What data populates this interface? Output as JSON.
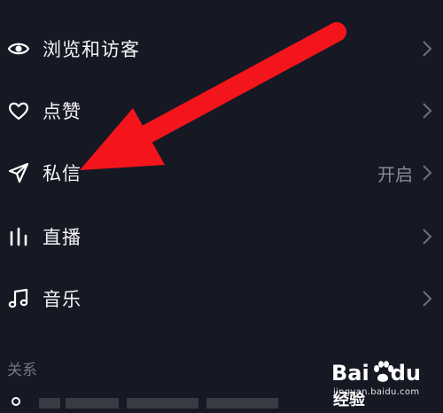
{
  "menu": {
    "items": [
      {
        "label": "浏览和访客",
        "icon": "eye-icon"
      },
      {
        "label": "点赞",
        "icon": "heart-icon"
      },
      {
        "label": "私信",
        "icon": "paper-plane-icon",
        "value": "开启"
      },
      {
        "label": "直播",
        "icon": "bar-chart-icon"
      },
      {
        "label": "音乐",
        "icon": "music-note-icon"
      }
    ]
  },
  "section": {
    "title": "关系"
  },
  "watermark": {
    "brand_prefix": "Bai",
    "brand_suffix": "经验",
    "url": "jingyan.baidu.com"
  },
  "colors": {
    "background": "#161823",
    "arrow": "#f4151c",
    "secondary_text": "#8a8b94"
  }
}
